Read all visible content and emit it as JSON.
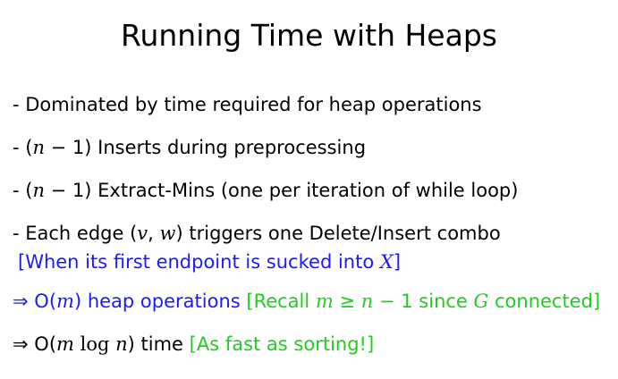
{
  "slide": {
    "title": "Running Time with Heaps",
    "bullets": [
      {
        "text": "- Dominated by time required for heap operations"
      },
      {
        "prefix": "- (",
        "var": "n",
        "suffix": " − 1) Inserts during preprocessing"
      },
      {
        "prefix": "- (",
        "var": "n",
        "suffix": " − 1) Extract-Mins (one per iteration of while loop)"
      },
      {
        "prefix": "- Each edge (",
        "var1": "v",
        "sep": ", ",
        "var2": "w",
        "suffix": ") triggers one Delete/Insert combo",
        "note_prefix": "[When its first endpoint is sucked into ",
        "note_var": "X",
        "note_suffix": "]"
      },
      {
        "arrow": "⇒",
        "o_open": "O(",
        "var": "m",
        "o_close": ")",
        "text": " heap operations",
        "note_prefix": " [Recall ",
        "note_var1": "m",
        "note_geq": " ≥ ",
        "note_var2": "n",
        "note_mid": " − 1 since ",
        "note_var3": "G",
        "note_suffix": " connected]"
      },
      {
        "arrow": "⇒",
        "o_open": "O(",
        "var": "m",
        "log": " log ",
        "var2": "n",
        "o_close": ")",
        "text": " time",
        "note": " [As fast as sorting!]"
      }
    ],
    "colors": {
      "text": "#000000",
      "blue": "#1a1aff",
      "green": "#22cc22",
      "background": "#ffffff"
    }
  }
}
